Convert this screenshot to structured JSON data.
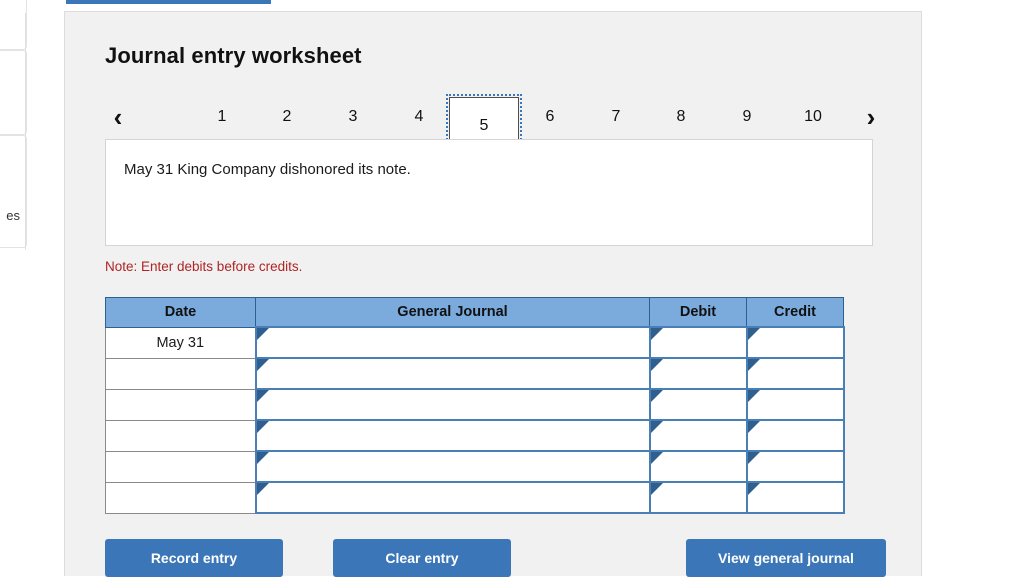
{
  "left_panel": {
    "clipped_label": "es"
  },
  "worksheet": {
    "title": "Journal entry worksheet",
    "pager": {
      "prev_icon": "chevron-left-icon",
      "next_icon": "chevron-right-icon",
      "prev_glyph": "‹",
      "next_glyph": "›",
      "pages": [
        "1",
        "2",
        "3",
        "4",
        "5",
        "6",
        "7",
        "8",
        "9",
        "10"
      ],
      "active_page": "5"
    },
    "transaction": {
      "text": "May 31 King Company dishonored its note."
    },
    "note": "Note: Enter debits before credits.",
    "table": {
      "headers": [
        "Date",
        "General Journal",
        "Debit",
        "Credit"
      ],
      "rows": [
        {
          "date": "May 31",
          "journal": "",
          "debit": "",
          "credit": ""
        },
        {
          "date": "",
          "journal": "",
          "debit": "",
          "credit": ""
        },
        {
          "date": "",
          "journal": "",
          "debit": "",
          "credit": ""
        },
        {
          "date": "",
          "journal": "",
          "debit": "",
          "credit": ""
        },
        {
          "date": "",
          "journal": "",
          "debit": "",
          "credit": ""
        },
        {
          "date": "",
          "journal": "",
          "debit": "",
          "credit": ""
        }
      ]
    },
    "buttons": {
      "record": "Record entry",
      "clear": "Clear entry",
      "view": "View general journal"
    }
  },
  "colors": {
    "accent_blue": "#3b77b8",
    "header_blue": "#7babdd",
    "cell_border_blue": "#4a7fb5",
    "note_red": "#b02424",
    "panel_bg": "#f1f1f1"
  }
}
